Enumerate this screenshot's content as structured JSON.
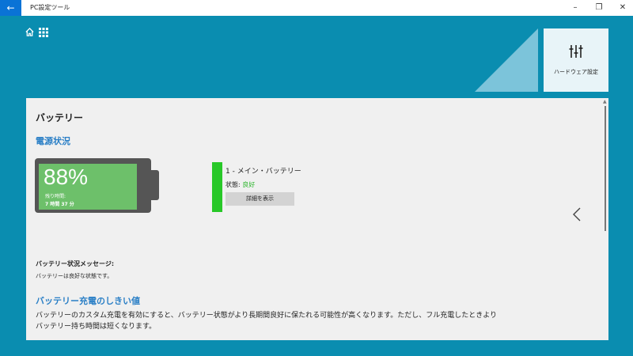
{
  "window": {
    "title": "PC設定ツール",
    "back_icon": "arrow-left-icon",
    "controls": [
      "–",
      "❐",
      "✕"
    ]
  },
  "nav": {
    "home_icon": "home-icon",
    "grid_icon": "grid-icon"
  },
  "tile": {
    "icon": "sliders-icon",
    "label": "ハードウェア設定"
  },
  "page": {
    "title": "バッテリー",
    "section_power": "電源状況",
    "battery": {
      "percent": "88%",
      "percent_value": 0.88,
      "remaining_label": "残り時間:",
      "remaining_value": "7 時間 37 分"
    },
    "status": {
      "name": "1 - メイン・バッテリー",
      "state_label": "状態: ",
      "state_value": "良好",
      "details_button": "詳細を表示"
    },
    "message": {
      "title": "バッテリー状況メッセージ:",
      "text": "バッテリーは良好な状態です。"
    },
    "threshold": {
      "title": "バッテリー充電のしきい値",
      "desc": "バッテリーのカスタム充電を有効にすると、バッテリー状態がより長期間良好に保たれる可能性が高くなります。ただし、フル充電したときより\nバッテリー持ち時間は短くなります。"
    }
  },
  "colors": {
    "background": "#0a8db0",
    "accent_blue": "#2a7fc6",
    "battery_green": "#6dc06a",
    "status_green": "#28c828"
  }
}
